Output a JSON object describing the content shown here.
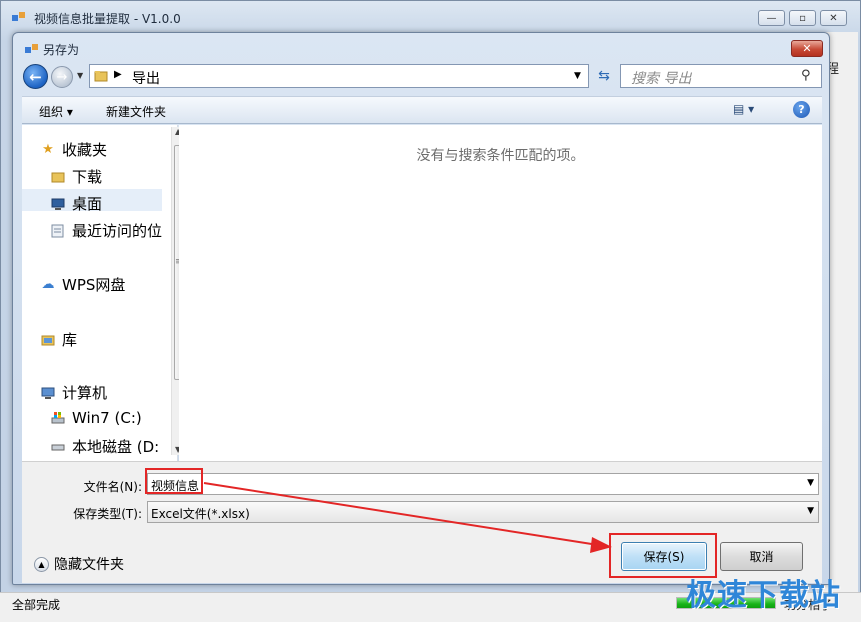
{
  "app": {
    "title": "视频信息批量提取 - V1.0.0",
    "side_text": "程",
    "minimize": "—",
    "maximize": "▫",
    "close": "✕",
    "status": "全部完成",
    "status_right": "功分相了",
    "progress_percent": 100
  },
  "watermark": "极速下载站",
  "dialog": {
    "title": "另存为",
    "close": "✕",
    "address": {
      "path": "导出"
    },
    "search_placeholder": "搜索 导出",
    "toolbar": {
      "organize": "组织 ▾",
      "new_folder": "新建文件夹",
      "view": "▤ ▾",
      "help": "?"
    },
    "nav_items": [
      {
        "label": "收藏夹",
        "icon": "star-icon"
      },
      {
        "label": "下载",
        "icon": "folder-icon"
      },
      {
        "label": "桌面",
        "icon": "desktop-icon",
        "selected": true
      },
      {
        "label": "最近访问的位",
        "icon": "recent-icon"
      },
      {
        "label": "WPS网盘",
        "icon": "cloud-icon"
      },
      {
        "label": "库",
        "icon": "library-icon"
      },
      {
        "label": "计算机",
        "icon": "computer-icon"
      },
      {
        "label": "Win7 (C:)",
        "icon": "drive-icon"
      },
      {
        "label": "本地磁盘 (D:",
        "icon": "disk-icon"
      }
    ],
    "empty_message": "没有与搜索条件匹配的项。",
    "filename_label": "文件名(N):",
    "filename_value": "视频信息",
    "filetype_label": "保存类型(T):",
    "filetype_value": "Excel文件(*.xlsx)",
    "hide_folders": "隐藏文件夹",
    "save_button": "保存(S)",
    "cancel_button": "取消"
  },
  "colors": {
    "annotation_red": "#e32626",
    "watermark_blue": "#2f86d8"
  }
}
